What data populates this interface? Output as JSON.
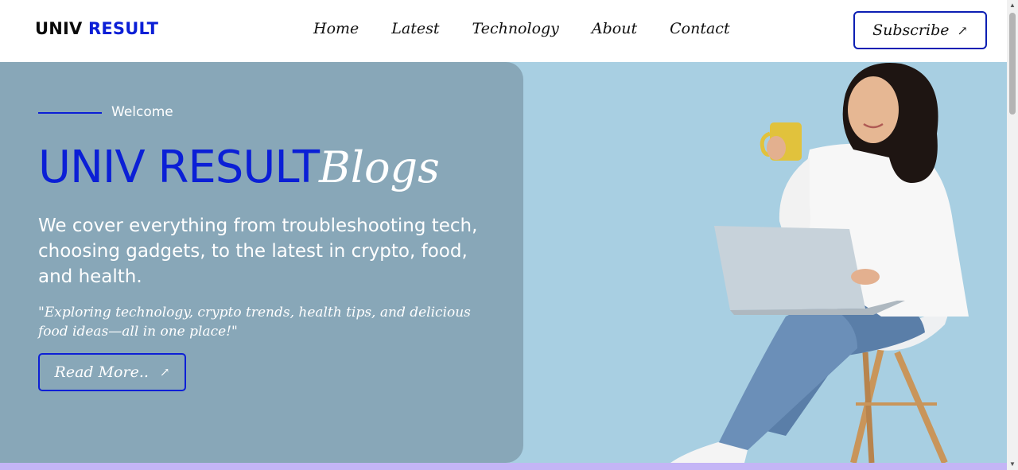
{
  "header": {
    "logo_part1": "UNIV",
    "logo_part2": "RESULT",
    "nav": [
      "Home",
      "Latest",
      "Technology",
      "About",
      "Contact"
    ],
    "subscribe_label": "Subscribe",
    "arrow_glyph": "↗"
  },
  "hero": {
    "welcome": "Welcome",
    "title_main": "UNIV RESULT",
    "title_script": "Blogs",
    "description": "We cover everything from troubleshooting tech, choosing gadgets, to the latest in crypto, food, and health.",
    "quote": "\"Exploring technology, crypto trends, health tips, and delicious food ideas—all in one place!\"",
    "readmore_label": "Read More..",
    "arrow_glyph": "↗"
  },
  "colors": {
    "brand_blue": "#0b1fd6",
    "hero_bg": "#a8cfe2",
    "panel_bg": "#88a7b8",
    "band": "#c4b5f6"
  },
  "icons": {
    "subscribe": "arrow-up-right-icon",
    "readmore": "arrow-up-right-icon",
    "scroll_up": "triangle-up-icon",
    "scroll_down": "triangle-down-icon"
  }
}
